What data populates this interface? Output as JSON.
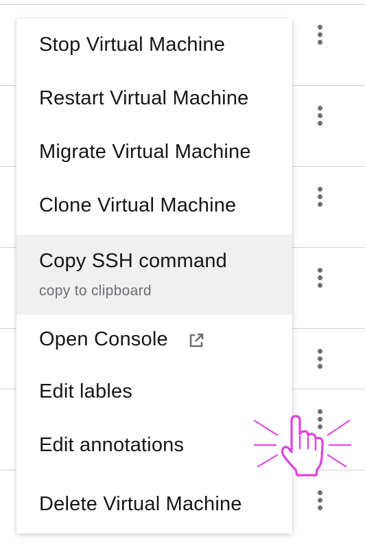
{
  "menu": {
    "items": [
      {
        "label": "Stop Virtual Machine"
      },
      {
        "label": "Restart Virtual Machine"
      },
      {
        "label": "Migrate Virtual Machine"
      },
      {
        "label": "Clone Virtual Machine"
      },
      {
        "label": "Copy SSH command",
        "description": "copy to clipboard",
        "highlighted": true
      },
      {
        "label": "Open Console",
        "icon": "external-link-icon"
      },
      {
        "label": "Edit lables"
      },
      {
        "label": "Edit annotations"
      },
      {
        "label": "Delete Virtual Machine"
      }
    ]
  },
  "table": {
    "row_action_icon": "kebab-menu-icon"
  },
  "cursor": {
    "icon": "hand-pointer-click-icon",
    "color": "#e040e0"
  },
  "colors": {
    "menu_text": "#151515",
    "description_text": "#6a6e73",
    "highlight_background": "#f0f0f0",
    "kebab_dots": "#6a6e73",
    "row_divider": "#d2d2d2"
  }
}
